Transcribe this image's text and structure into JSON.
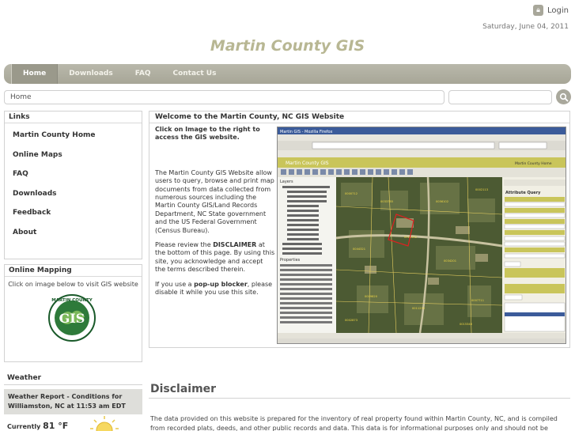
{
  "header": {
    "login_label": "Login",
    "date": "Saturday, June 04, 2011",
    "site_title": "Martin County GIS"
  },
  "nav": {
    "items": [
      {
        "label": "Home",
        "active": true
      },
      {
        "label": "Downloads",
        "active": false
      },
      {
        "label": "FAQ",
        "active": false
      },
      {
        "label": "Contact Us",
        "active": false
      }
    ]
  },
  "breadcrumb": "Home",
  "search": {
    "placeholder": ""
  },
  "links": {
    "title": "Links",
    "items": [
      "Martin County Home",
      "Online Maps",
      "FAQ",
      "Downloads",
      "Feedback",
      "About"
    ]
  },
  "mapping": {
    "title": "Online Mapping",
    "caption": "Click on image below to visit GIS website",
    "logo_text": "GIS",
    "logo_ring_text": "MARTIN COUNTY"
  },
  "weather": {
    "title": "Weather",
    "report": "Weather Report - Conditions for Williamston, NC at 11:53 am EDT",
    "current_label": "Currently",
    "current_temp": "81 °F"
  },
  "welcome": {
    "title": "Welcome to the Martin County, NC GIS Website",
    "intro": "Click on Image to the right to access the GIS website.",
    "para1": "The Martin County GIS Website allow users to query, browse and print map documents from data collected from numerous sources including the Martin County GIS/Land Records Department, NC State government and the US Federal Government (Census Bureau).",
    "para2_before": "Please review the ",
    "para2_bold": "DISCLAIMER",
    "para2_after": " at the bottom of this page.  By using this site, you acknowledge and accept the terms described therein.",
    "para3_before": "If you use a ",
    "para3_bold": "pop-up blocker",
    "para3_after": ", please disable it while you use this site."
  },
  "thumbnail": {
    "window_title": "Martin GIS - Mozilla Firefox",
    "app_title": "Martin County GIS",
    "app_home": "Martin County Home",
    "attribute_query": "Attribute Query",
    "layers": "Layers",
    "properties": "Properties"
  },
  "disclaimer": {
    "title": "Disclaimer",
    "text": "The data provided on this website is prepared for the inventory of real property found within Martin County, NC, and is compiled from recorded plats, deeds, and other public records and data.  This data is for informational purposes only and should not be substituted for a true title search,"
  },
  "colors": {
    "nav_bg": "#a7a697",
    "title_color": "#b8b793",
    "map_bg": "#4c5a33"
  }
}
